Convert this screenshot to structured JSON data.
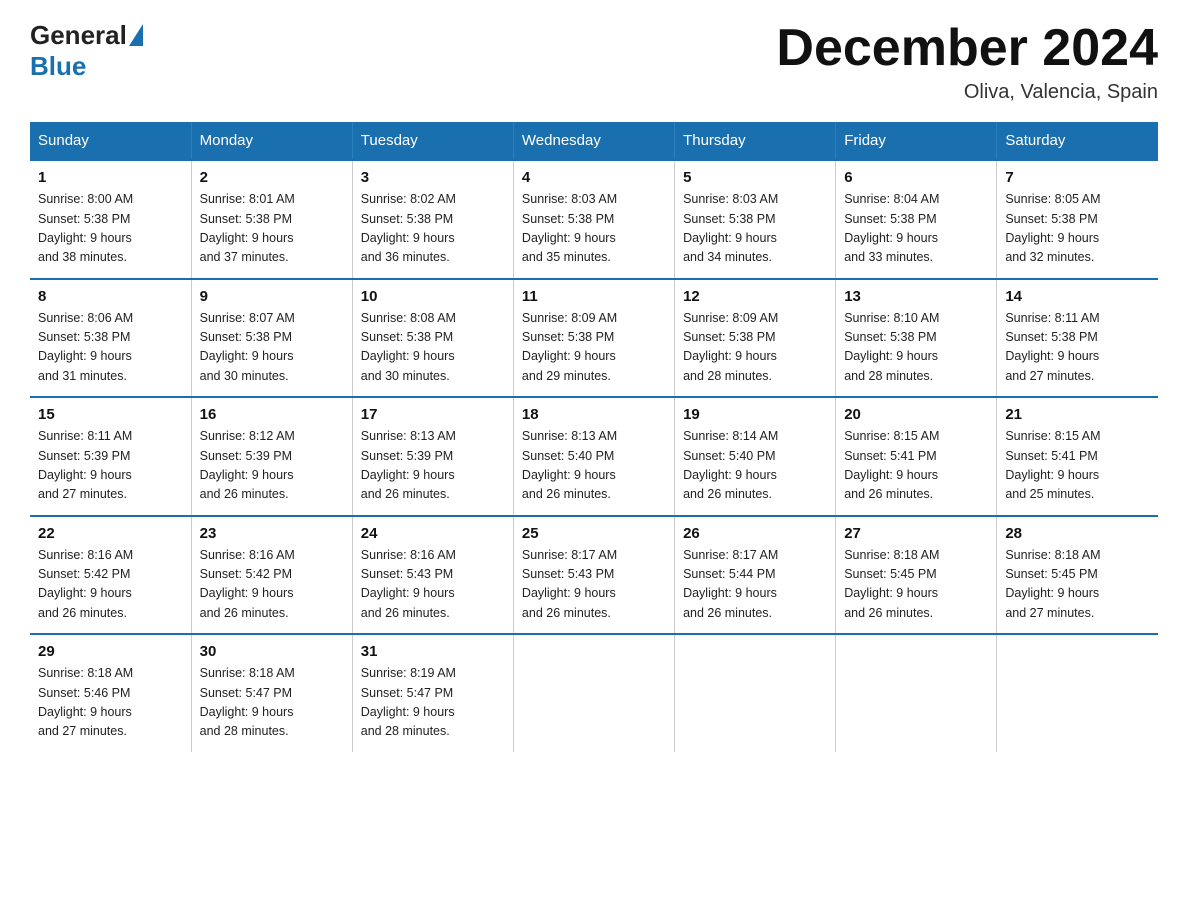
{
  "header": {
    "logo_general": "General",
    "logo_blue": "Blue",
    "month_title": "December 2024",
    "location": "Oliva, Valencia, Spain"
  },
  "days_of_week": [
    "Sunday",
    "Monday",
    "Tuesday",
    "Wednesday",
    "Thursday",
    "Friday",
    "Saturday"
  ],
  "weeks": [
    [
      {
        "day": "1",
        "sunrise": "8:00 AM",
        "sunset": "5:38 PM",
        "daylight": "9 hours and 38 minutes."
      },
      {
        "day": "2",
        "sunrise": "8:01 AM",
        "sunset": "5:38 PM",
        "daylight": "9 hours and 37 minutes."
      },
      {
        "day": "3",
        "sunrise": "8:02 AM",
        "sunset": "5:38 PM",
        "daylight": "9 hours and 36 minutes."
      },
      {
        "day": "4",
        "sunrise": "8:03 AM",
        "sunset": "5:38 PM",
        "daylight": "9 hours and 35 minutes."
      },
      {
        "day": "5",
        "sunrise": "8:03 AM",
        "sunset": "5:38 PM",
        "daylight": "9 hours and 34 minutes."
      },
      {
        "day": "6",
        "sunrise": "8:04 AM",
        "sunset": "5:38 PM",
        "daylight": "9 hours and 33 minutes."
      },
      {
        "day": "7",
        "sunrise": "8:05 AM",
        "sunset": "5:38 PM",
        "daylight": "9 hours and 32 minutes."
      }
    ],
    [
      {
        "day": "8",
        "sunrise": "8:06 AM",
        "sunset": "5:38 PM",
        "daylight": "9 hours and 31 minutes."
      },
      {
        "day": "9",
        "sunrise": "8:07 AM",
        "sunset": "5:38 PM",
        "daylight": "9 hours and 30 minutes."
      },
      {
        "day": "10",
        "sunrise": "8:08 AM",
        "sunset": "5:38 PM",
        "daylight": "9 hours and 30 minutes."
      },
      {
        "day": "11",
        "sunrise": "8:09 AM",
        "sunset": "5:38 PM",
        "daylight": "9 hours and 29 minutes."
      },
      {
        "day": "12",
        "sunrise": "8:09 AM",
        "sunset": "5:38 PM",
        "daylight": "9 hours and 28 minutes."
      },
      {
        "day": "13",
        "sunrise": "8:10 AM",
        "sunset": "5:38 PM",
        "daylight": "9 hours and 28 minutes."
      },
      {
        "day": "14",
        "sunrise": "8:11 AM",
        "sunset": "5:38 PM",
        "daylight": "9 hours and 27 minutes."
      }
    ],
    [
      {
        "day": "15",
        "sunrise": "8:11 AM",
        "sunset": "5:39 PM",
        "daylight": "9 hours and 27 minutes."
      },
      {
        "day": "16",
        "sunrise": "8:12 AM",
        "sunset": "5:39 PM",
        "daylight": "9 hours and 26 minutes."
      },
      {
        "day": "17",
        "sunrise": "8:13 AM",
        "sunset": "5:39 PM",
        "daylight": "9 hours and 26 minutes."
      },
      {
        "day": "18",
        "sunrise": "8:13 AM",
        "sunset": "5:40 PM",
        "daylight": "9 hours and 26 minutes."
      },
      {
        "day": "19",
        "sunrise": "8:14 AM",
        "sunset": "5:40 PM",
        "daylight": "9 hours and 26 minutes."
      },
      {
        "day": "20",
        "sunrise": "8:15 AM",
        "sunset": "5:41 PM",
        "daylight": "9 hours and 26 minutes."
      },
      {
        "day": "21",
        "sunrise": "8:15 AM",
        "sunset": "5:41 PM",
        "daylight": "9 hours and 25 minutes."
      }
    ],
    [
      {
        "day": "22",
        "sunrise": "8:16 AM",
        "sunset": "5:42 PM",
        "daylight": "9 hours and 26 minutes."
      },
      {
        "day": "23",
        "sunrise": "8:16 AM",
        "sunset": "5:42 PM",
        "daylight": "9 hours and 26 minutes."
      },
      {
        "day": "24",
        "sunrise": "8:16 AM",
        "sunset": "5:43 PM",
        "daylight": "9 hours and 26 minutes."
      },
      {
        "day": "25",
        "sunrise": "8:17 AM",
        "sunset": "5:43 PM",
        "daylight": "9 hours and 26 minutes."
      },
      {
        "day": "26",
        "sunrise": "8:17 AM",
        "sunset": "5:44 PM",
        "daylight": "9 hours and 26 minutes."
      },
      {
        "day": "27",
        "sunrise": "8:18 AM",
        "sunset": "5:45 PM",
        "daylight": "9 hours and 26 minutes."
      },
      {
        "day": "28",
        "sunrise": "8:18 AM",
        "sunset": "5:45 PM",
        "daylight": "9 hours and 27 minutes."
      }
    ],
    [
      {
        "day": "29",
        "sunrise": "8:18 AM",
        "sunset": "5:46 PM",
        "daylight": "9 hours and 27 minutes."
      },
      {
        "day": "30",
        "sunrise": "8:18 AM",
        "sunset": "5:47 PM",
        "daylight": "9 hours and 28 minutes."
      },
      {
        "day": "31",
        "sunrise": "8:19 AM",
        "sunset": "5:47 PM",
        "daylight": "9 hours and 28 minutes."
      },
      null,
      null,
      null,
      null
    ]
  ]
}
